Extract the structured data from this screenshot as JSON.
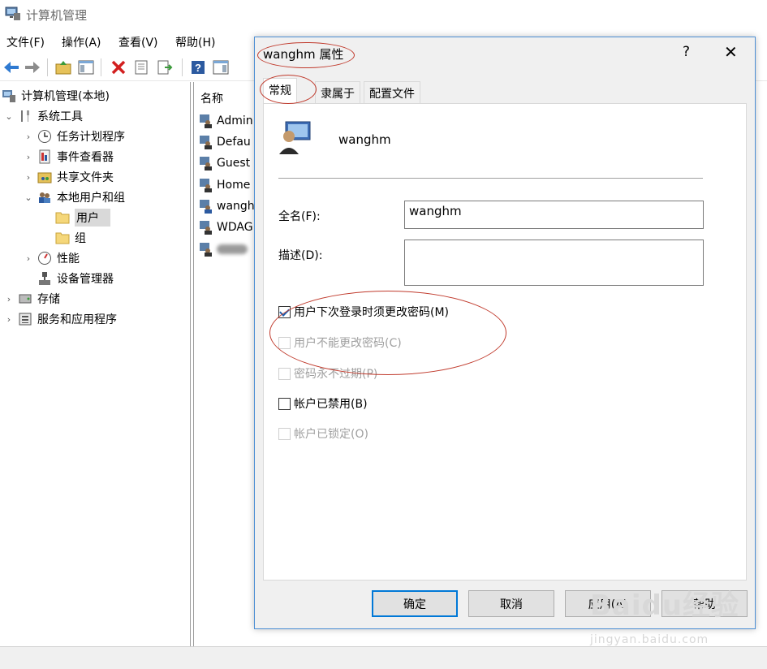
{
  "window": {
    "title": "计算机管理"
  },
  "menu": [
    "文件(F)",
    "操作(A)",
    "查看(V)",
    "帮助(H)"
  ],
  "toolbar": {
    "icons": [
      "back-arrow-icon",
      "forward-arrow-icon",
      "up-folder-icon",
      "show-hide-tree-icon",
      "delete-icon",
      "properties-icon",
      "export-icon",
      "help-icon",
      "action-pane-icon"
    ]
  },
  "tree": {
    "root": "计算机管理(本地)",
    "system_tools": "系统工具",
    "task_scheduler": "任务计划程序",
    "event_viewer": "事件查看器",
    "shared_folders": "共享文件夹",
    "local_users_groups": "本地用户和组",
    "users": "用户",
    "groups": "组",
    "performance": "性能",
    "device_manager": "设备管理器",
    "storage": "存储",
    "services_apps": "服务和应用程序"
  },
  "list": {
    "header": "名称",
    "rows": [
      "Admin",
      "Defau",
      "Guest",
      "Home",
      "wangh",
      "WDAG"
    ]
  },
  "dialog": {
    "title": "wanghm 属性",
    "help_glyph": "?",
    "close_glyph": "✕",
    "tabs": [
      "常规",
      "隶属于",
      "配置文件"
    ],
    "username": "wanghm",
    "fullname_label": "全名(F):",
    "fullname_value": "wanghm",
    "description_label": "描述(D):",
    "description_value": "",
    "checkboxes": [
      {
        "label": "用户下次登录时须更改密码(M)",
        "checked": true,
        "enabled": true
      },
      {
        "label": "用户不能更改密码(C)",
        "checked": false,
        "enabled": false
      },
      {
        "label": "密码永不过期(P)",
        "checked": false,
        "enabled": false
      },
      {
        "label": "帐户已禁用(B)",
        "checked": false,
        "enabled": true
      },
      {
        "label": "帐户已锁定(O)",
        "checked": false,
        "enabled": false
      }
    ],
    "buttons": {
      "ok": "确定",
      "cancel": "取消",
      "apply": "应用(A)",
      "help": "帮助"
    }
  },
  "watermark": {
    "text": "Baidu经验",
    "sub": "jingyan.baidu.com"
  },
  "colors": {
    "accent": "#0078d7",
    "annotation": "#c0392b",
    "dialog_border": "#4d8fd4"
  }
}
